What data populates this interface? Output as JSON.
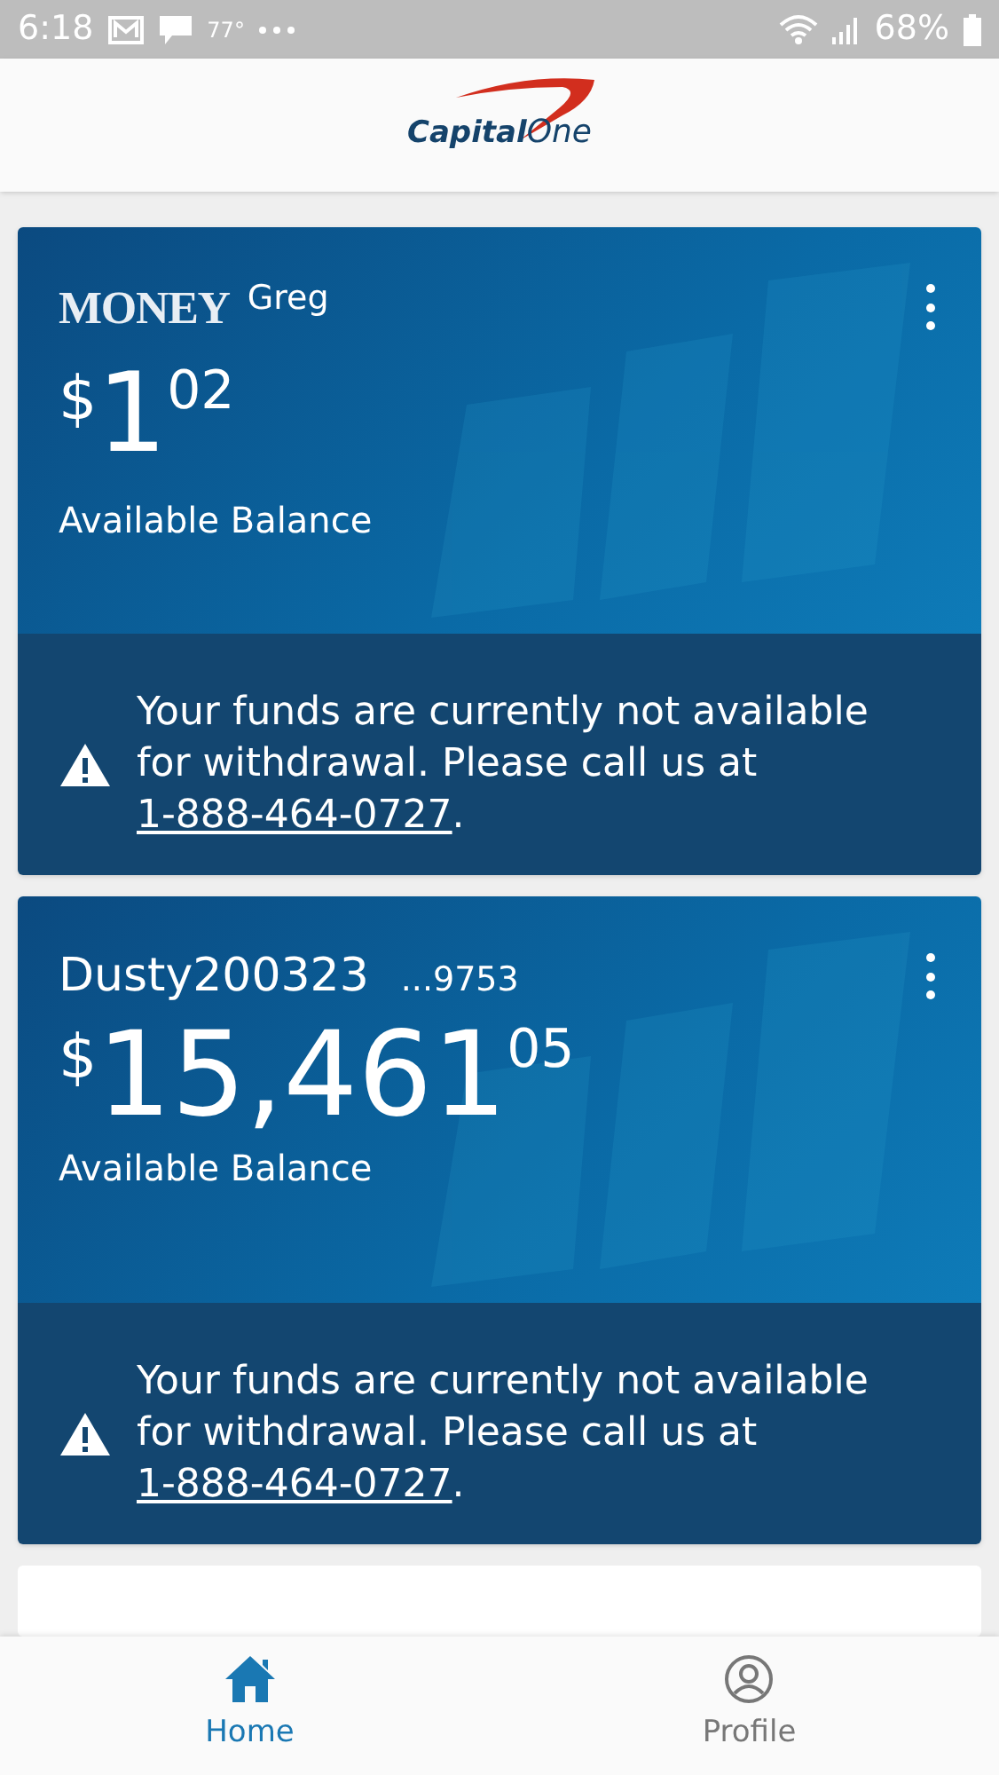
{
  "status_bar": {
    "time": "6:18",
    "temperature": "77°",
    "battery": "68%"
  },
  "header": {
    "logo_word_1": "Capital",
    "logo_word_2": "One"
  },
  "accounts": [
    {
      "kind": "brand",
      "brand": "MONEY",
      "name": "Greg",
      "currency": "$",
      "whole": "1",
      "cents": "02",
      "balance_label": "Available Balance",
      "notice": "Your funds are currently not available for withdrawal. Please call us at",
      "phone": "1-888-464-0727",
      "notice_end": "."
    },
    {
      "kind": "plain",
      "name": "Dusty200323",
      "account_number": "...9753",
      "currency": "$",
      "whole": "15,461",
      "cents": "05",
      "balance_label": "Available Balance",
      "notice": "Your funds are currently not available for withdrawal. Please call us at",
      "phone": "1-888-464-0727",
      "notice_end": "."
    }
  ],
  "bottom_nav": [
    {
      "label": "Home",
      "kind": "home",
      "selected": true
    },
    {
      "label": "Profile",
      "kind": "profile",
      "selected": false
    }
  ]
}
